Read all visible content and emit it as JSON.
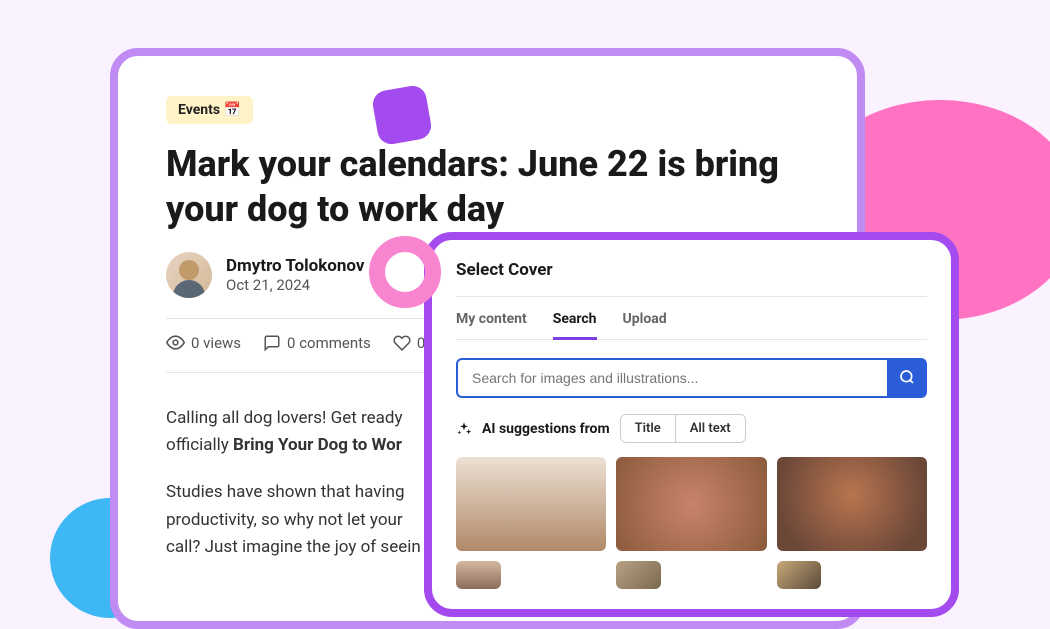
{
  "article": {
    "category": "Events 📅",
    "title": "Mark your calendars: June 22 is bring your dog to work day",
    "author_name": "Dmytro Tolokonov",
    "date": "Oct 21, 2024",
    "views": "0 views",
    "comments": "0 comments",
    "likes_partial": "0",
    "para1_lead": "Calling all dog lovers! Get ready ",
    "para1_bold": "Bring Your Dog to Wor",
    "para1_pre": "officially ",
    "para2": "Studies have shown that having",
    "para2b": "productivity, so why not let your",
    "para2c": "call? Just imagine the joy of seein"
  },
  "modal": {
    "title": "Select Cover",
    "tabs": {
      "my_content": "My content",
      "search": "Search",
      "upload": "Upload"
    },
    "search_placeholder": "Search for images and illustrations...",
    "suggestions_label": "AI suggestions from",
    "chip_title": "Title",
    "chip_alltext": "All text"
  }
}
